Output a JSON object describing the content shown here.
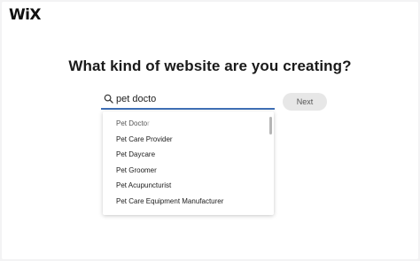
{
  "brand": {
    "logo": "WiX"
  },
  "heading": "What kind of website are you creating?",
  "search": {
    "value": "pet docto",
    "icon": "search-icon"
  },
  "next_button": {
    "label": "Next"
  },
  "suggestions": [
    {
      "label": "Pet Docto",
      "label_suffix": "r"
    },
    {
      "label": "Pet Care Provider"
    },
    {
      "label": "Pet Daycare"
    },
    {
      "label": "Pet Groomer"
    },
    {
      "label": "Pet Acupuncturist"
    },
    {
      "label": "Pet Care Equipment Manufacturer"
    }
  ],
  "colors": {
    "accent": "#3f6fb5",
    "background": "#ffffff",
    "button_bg": "#e7e7e7"
  }
}
